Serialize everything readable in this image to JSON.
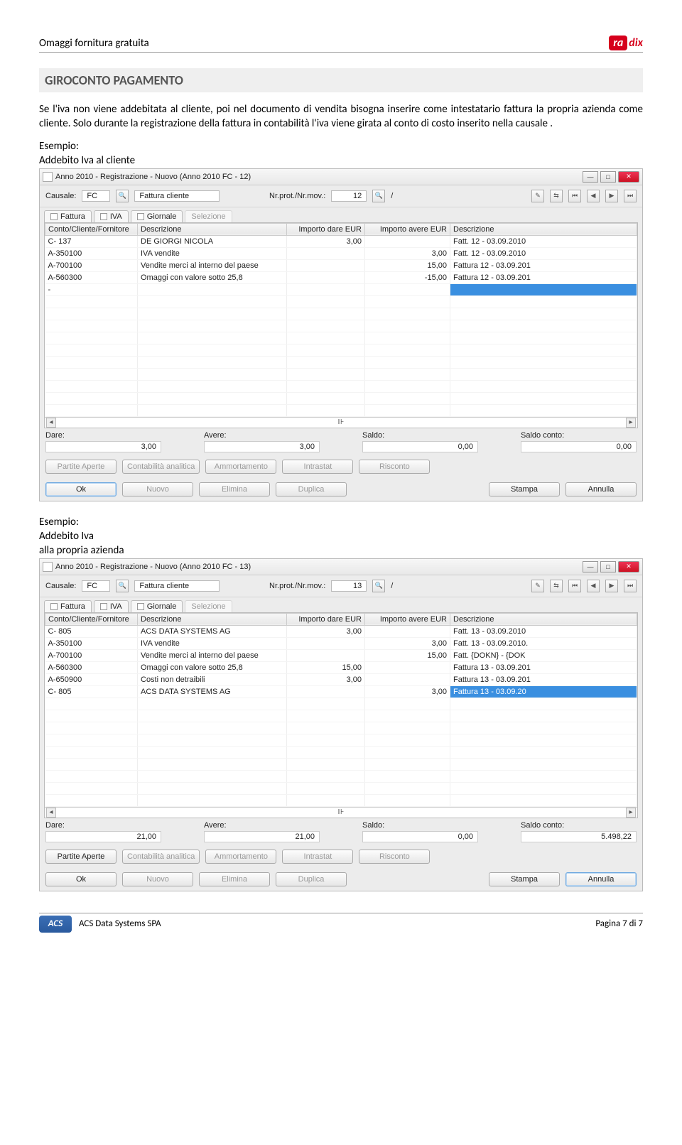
{
  "header": {
    "left": "Omaggi fornitura gratuita",
    "brand_box": "ra",
    "brand_suffix": "dix"
  },
  "section_title": "GIROCONTO PAGAMENTO",
  "paragraph": "Se l'iva non viene addebitata al cliente, poi nel documento di vendita bisogna inserire come intestatario fattura la propria azienda come cliente. Solo durante la registrazione della fattura in contabilità l'iva viene girata al conto di costo inserito nella causale .",
  "example1_label1": "Esempio:",
  "example1_label2": "Addebito Iva al cliente",
  "example2_label1": "Esempio:",
  "example2_label2": "Addebito Iva",
  "example2_label3": "alla propria azienda",
  "win1": {
    "title": "Anno 2010 - Registrazione - Nuovo (Anno 2010  FC - 12)",
    "causale_lbl": "Causale:",
    "causale_code": "FC",
    "causale_desc": "Fattura cliente",
    "nrprot_lbl": "Nr.prot./Nr.mov.:",
    "nrprot_val": "12",
    "tabs": {
      "fattura": "Fattura",
      "iva": "IVA",
      "giornale": "Giornale",
      "selezione": "Selezione"
    },
    "cols": {
      "c1": "Conto/Cliente/Fornitore",
      "c2": "Descrizione",
      "c3": "Importo dare EUR",
      "c4": "Importo avere EUR",
      "c5": "Descrizione"
    },
    "rows": [
      {
        "conto": "C-   137",
        "descr": "DE GIORGI NICOLA",
        "dare": "3,00",
        "avere": "",
        "desc2": "Fatt. 12 - 03.09.2010"
      },
      {
        "conto": "A-350100",
        "descr": "IVA vendite",
        "dare": "",
        "avere": "3,00",
        "desc2": "Fatt. 12 - 03.09.2010"
      },
      {
        "conto": "A-700100",
        "descr": "Vendite merci al interno del paese",
        "dare": "",
        "avere": "15,00",
        "desc2": "Fattura 12 - 03.09.201"
      },
      {
        "conto": "A-560300",
        "descr": "Omaggi con valore sotto 25,8",
        "dare": "",
        "avere": "-15,00",
        "desc2": "Fattura 12 - 03.09.201"
      },
      {
        "conto": "-",
        "descr": "",
        "dare": "",
        "avere": "",
        "desc2": "",
        "hl": true
      }
    ],
    "totals": {
      "dare_lbl": "Dare:",
      "dare": "3,00",
      "avere_lbl": "Avere:",
      "avere": "3,00",
      "saldo_lbl": "Saldo:",
      "saldo": "0,00",
      "saldoc_lbl": "Saldo conto:",
      "saldoc": "0,00"
    },
    "buttons1": {
      "partite": "Partite Aperte",
      "cont": "Contabilità analitica",
      "amm": "Ammortamento",
      "intr": "Intrastat",
      "risc": "Risconto"
    },
    "buttons2": {
      "ok": "Ok",
      "nuovo": "Nuovo",
      "elimina": "Elimina",
      "duplica": "Duplica",
      "stampa": "Stampa",
      "annulla": "Annulla"
    }
  },
  "win2": {
    "title": "Anno 2010 - Registrazione - Nuovo (Anno 2010  FC - 13)",
    "causale_lbl": "Causale:",
    "causale_code": "FC",
    "causale_desc": "Fattura cliente",
    "nrprot_lbl": "Nr.prot./Nr.mov.:",
    "nrprot_val": "13",
    "tabs": {
      "fattura": "Fattura",
      "iva": "IVA",
      "giornale": "Giornale",
      "selezione": "Selezione"
    },
    "cols": {
      "c1": "Conto/Cliente/Fornitore",
      "c2": "Descrizione",
      "c3": "Importo dare EUR",
      "c4": "Importo avere EUR",
      "c5": "Descrizione"
    },
    "rows": [
      {
        "conto": "C-   805",
        "descr": "ACS DATA SYSTEMS AG",
        "dare": "3,00",
        "avere": "",
        "desc2": "Fatt. 13 - 03.09.2010"
      },
      {
        "conto": "A-350100",
        "descr": "IVA vendite",
        "dare": "",
        "avere": "3,00",
        "desc2": "Fatt. 13 - 03.09.2010."
      },
      {
        "conto": "A-700100",
        "descr": "Vendite merci al interno del paese",
        "dare": "",
        "avere": "15,00",
        "desc2": "Fatt. {DOKN} - {DOK"
      },
      {
        "conto": "A-560300",
        "descr": "Omaggi con valore sotto 25,8",
        "dare": "15,00",
        "avere": "",
        "desc2": "Fattura 13 - 03.09.201"
      },
      {
        "conto": "A-650900",
        "descr": "Costi non detraibili",
        "dare": "3,00",
        "avere": "",
        "desc2": "Fattura 13 - 03.09.201"
      },
      {
        "conto": "C-   805",
        "descr": "ACS DATA SYSTEMS AG",
        "dare": "",
        "avere": "3,00",
        "desc2": "Fattura 13 - 03.09.20",
        "hl": true
      }
    ],
    "totals": {
      "dare_lbl": "Dare:",
      "dare": "21,00",
      "avere_lbl": "Avere:",
      "avere": "21,00",
      "saldo_lbl": "Saldo:",
      "saldo": "0,00",
      "saldoc_lbl": "Saldo conto:",
      "saldoc": "5.498,22"
    },
    "buttons1": {
      "partite": "Partite Aperte",
      "cont": "Contabilità analitica",
      "amm": "Ammortamento",
      "intr": "Intrastat",
      "risc": "Risconto"
    },
    "buttons2": {
      "ok": "Ok",
      "nuovo": "Nuovo",
      "elimina": "Elimina",
      "duplica": "Duplica",
      "stampa": "Stampa",
      "annulla": "Annulla"
    }
  },
  "footer": {
    "logo": "ACS",
    "company": "ACS Data Systems SPA",
    "page": "Pagina 7 di  7"
  }
}
